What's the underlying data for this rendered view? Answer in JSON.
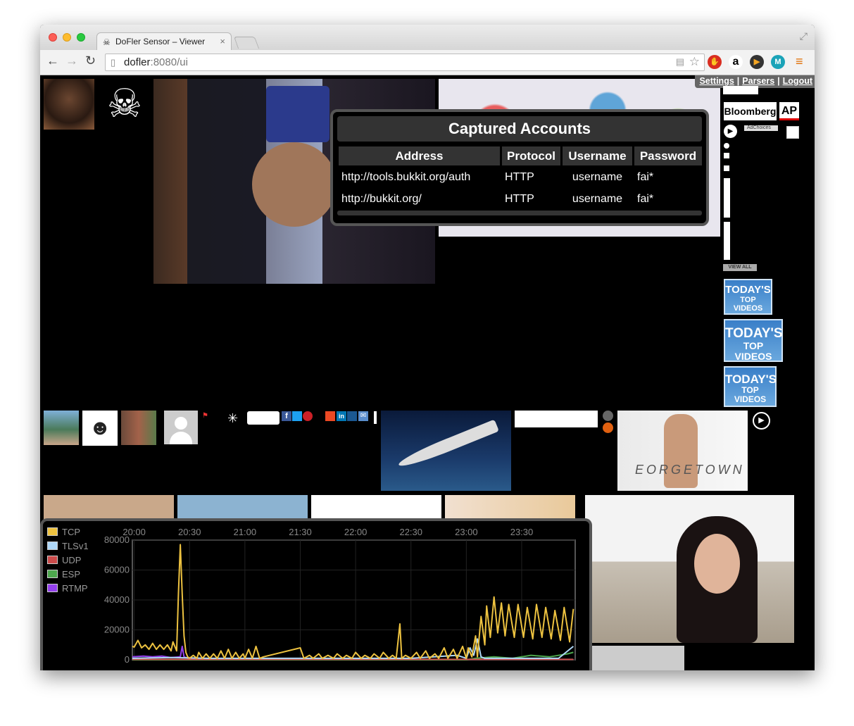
{
  "browser": {
    "tab_title": "DoFler Sensor – Viewer",
    "url_host": "dofler",
    "url_rest": ":8080/ui"
  },
  "nav": {
    "settings": "Settings",
    "parsers": "Parsers",
    "logout": "Logout"
  },
  "side_ads": {
    "bloomberg": "Bloomberg",
    "ap": "AP",
    "adchoices": "AdChoices",
    "view_all": "VIEW ALL",
    "top_videos_line1": "TODAY'S",
    "top_videos_line2": "TOP VIDEOS"
  },
  "banner_text": "EORGETOWN",
  "accounts": {
    "title": "Captured Accounts",
    "columns": [
      "Address",
      "Protocol",
      "Username",
      "Password"
    ],
    "rows": [
      [
        "http://tools.bukkit.org/auth",
        "HTTP",
        "username",
        "fai*"
      ],
      [
        "http://bukkit.org/",
        "HTTP",
        "username",
        "fai*"
      ]
    ]
  },
  "chart_data": {
    "type": "line",
    "legend_position": "top-left",
    "x_ticks": [
      "20:00",
      "20:30",
      "21:00",
      "21:30",
      "22:00",
      "22:30",
      "23:00",
      "23:30"
    ],
    "y_ticks": [
      0,
      20000,
      40000,
      60000,
      80000
    ],
    "ylim": [
      0,
      80000
    ],
    "grid": true,
    "series": [
      {
        "name": "TCP",
        "color": "#edc240",
        "x": [
          "19:59",
          "20:00",
          "20:02",
          "20:04",
          "20:06",
          "20:08",
          "20:10",
          "20:12",
          "20:14",
          "20:16",
          "20:18",
          "20:20",
          "20:21",
          "20:23",
          "20:24",
          "20:25",
          "20:26",
          "20:27",
          "20:28",
          "20:29",
          "20:30",
          "20:32",
          "20:34",
          "20:35",
          "20:37",
          "20:39",
          "20:41",
          "20:43",
          "20:45",
          "20:47",
          "20:49",
          "20:51",
          "20:53",
          "20:55",
          "20:57",
          "20:59",
          "21:00",
          "21:02",
          "21:04",
          "21:06",
          "21:08",
          "21:10",
          "21:30",
          "21:32",
          "21:35",
          "21:37",
          "21:40",
          "21:42",
          "21:45",
          "21:48",
          "21:50",
          "21:53",
          "21:55",
          "21:58",
          "22:00",
          "22:03",
          "22:05",
          "22:08",
          "22:10",
          "22:13",
          "22:15",
          "22:18",
          "22:20",
          "22:22",
          "22:24",
          "22:25",
          "22:27",
          "22:30",
          "22:33",
          "22:35",
          "22:38",
          "22:40",
          "22:43",
          "22:45",
          "22:48",
          "22:50",
          "22:53",
          "22:55",
          "22:58",
          "23:00",
          "23:01",
          "23:03",
          "23:05",
          "23:06",
          "23:08",
          "23:10",
          "23:11",
          "23:13",
          "23:15",
          "23:17",
          "23:19",
          "23:21",
          "23:23",
          "23:26",
          "23:28",
          "23:31",
          "23:33",
          "23:36",
          "23:38",
          "23:41",
          "23:43",
          "23:46",
          "23:48",
          "23:51",
          "23:53",
          "23:56",
          "23:58"
        ],
        "y": [
          9000,
          8500,
          13000,
          8000,
          10000,
          7000,
          11000,
          7000,
          10000,
          7000,
          10000,
          6000,
          12000,
          6000,
          45000,
          77000,
          44000,
          16000,
          5000,
          2000,
          1000,
          3000,
          1000,
          5000,
          1000,
          4000,
          1000,
          4000,
          1000,
          6000,
          1000,
          7000,
          1000,
          5000,
          1000,
          4000,
          1000,
          7000,
          1000,
          9000,
          1000,
          2000,
          8000,
          1000,
          3000,
          1000,
          4000,
          1000,
          3000,
          1000,
          4000,
          1000,
          3000,
          1000,
          5000,
          1000,
          3000,
          1000,
          4000,
          1000,
          5000,
          1000,
          3000,
          1000,
          24000,
          1000,
          3000,
          1000,
          5000,
          1000,
          6000,
          1000,
          4000,
          1000,
          8000,
          1000,
          7000,
          1000,
          9000,
          1000,
          8000,
          2000,
          16000,
          2000,
          29000,
          10000,
          36000,
          15000,
          42000,
          18000,
          38000,
          16000,
          37000,
          15000,
          37000,
          15000,
          35000,
          14000,
          37000,
          15000,
          35000,
          14000,
          33000,
          13000,
          35000,
          12000,
          34000
        ]
      },
      {
        "name": "TLSv1",
        "color": "#afd8f8",
        "x": [
          "19:59",
          "20:20",
          "20:40",
          "21:00",
          "21:30",
          "22:00",
          "22:30",
          "22:55",
          "23:00",
          "23:02",
          "23:04",
          "23:06",
          "23:08",
          "23:10",
          "23:20",
          "23:30",
          "23:40",
          "23:50",
          "23:58"
        ],
        "y": [
          1000,
          1500,
          1000,
          1000,
          1000,
          1000,
          1000,
          3000,
          1000,
          8000,
          3000,
          14000,
          2000,
          1000,
          1000,
          1000,
          1000,
          1000,
          9000
        ]
      },
      {
        "name": "UDP",
        "color": "#cb4b4b",
        "x": [
          "19:59",
          "21:00",
          "22:00",
          "23:00",
          "23:58"
        ],
        "y": [
          300,
          300,
          300,
          300,
          300
        ]
      },
      {
        "name": "ESP",
        "color": "#4da74d",
        "x": [
          "19:59",
          "20:30",
          "21:00",
          "22:00",
          "23:00",
          "23:05",
          "23:15",
          "23:25",
          "23:35",
          "23:45",
          "23:55",
          "23:58"
        ],
        "y": [
          0,
          0,
          0,
          0,
          0,
          1000,
          2000,
          1000,
          3000,
          2000,
          4000,
          5000
        ]
      },
      {
        "name": "RTMP",
        "color": "#9440ed",
        "x": [
          "19:59",
          "20:05",
          "20:10",
          "20:15",
          "20:20",
          "20:25",
          "20:26",
          "20:27",
          "20:28",
          "20:30",
          "20:35",
          "21:00",
          "21:30",
          "22:00"
        ],
        "y": [
          2000,
          2500,
          2000,
          2500,
          1500,
          2000,
          9000,
          2000,
          1500,
          1000,
          500,
          300,
          300,
          300
        ]
      }
    ]
  }
}
